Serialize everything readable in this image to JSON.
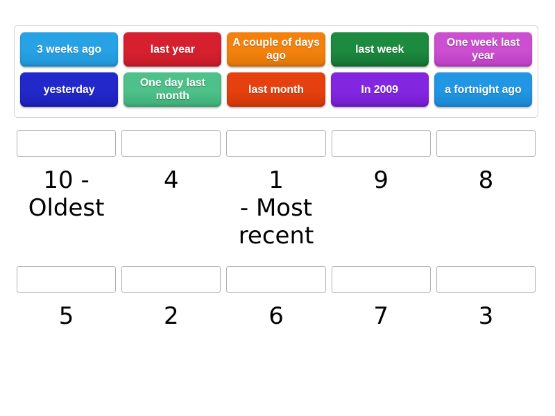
{
  "activity": {
    "type": "rank-order",
    "tray": {
      "rows": [
        [
          {
            "label": "3 weeks ago",
            "color": "#27a3e5",
            "color_dark": "#1f93d4"
          },
          {
            "label": "last year",
            "color": "#d7202f",
            "color_dark": "#c31b29"
          },
          {
            "label": "A couple of\ndays ago",
            "color": "#f2820d",
            "color_dark": "#e07608"
          },
          {
            "label": "last week",
            "color": "#1c8a3f",
            "color_dark": "#157233"
          },
          {
            "label": "One week\nlast year",
            "color": "#cb4fd0",
            "color_dark": "#bb3fc3"
          }
        ],
        [
          {
            "label": "yesterday",
            "color": "#2328cb",
            "color_dark": "#1b20b4"
          },
          {
            "label": "One day\nlast month",
            "color": "#4ec08a",
            "color_dark": "#3fae79"
          },
          {
            "label": "last month",
            "color": "#e5400d",
            "color_dark": "#cf3709"
          },
          {
            "label": "In 2009",
            "color": "#8326e0",
            "color_dark": "#731dcc"
          },
          {
            "label": "a fortnight\nago",
            "color": "#2196e3",
            "color_dark": "#1b87d2"
          }
        ]
      ]
    },
    "slots": {
      "rows": [
        [
          {
            "rank": "10 -\nOldest"
          },
          {
            "rank": "4"
          },
          {
            "rank": "1\n- Most recent"
          },
          {
            "rank": "9"
          },
          {
            "rank": "8"
          }
        ],
        [
          {
            "rank": "5"
          },
          {
            "rank": "2"
          },
          {
            "rank": "6"
          },
          {
            "rank": "7"
          },
          {
            "rank": "3"
          }
        ]
      ]
    }
  }
}
